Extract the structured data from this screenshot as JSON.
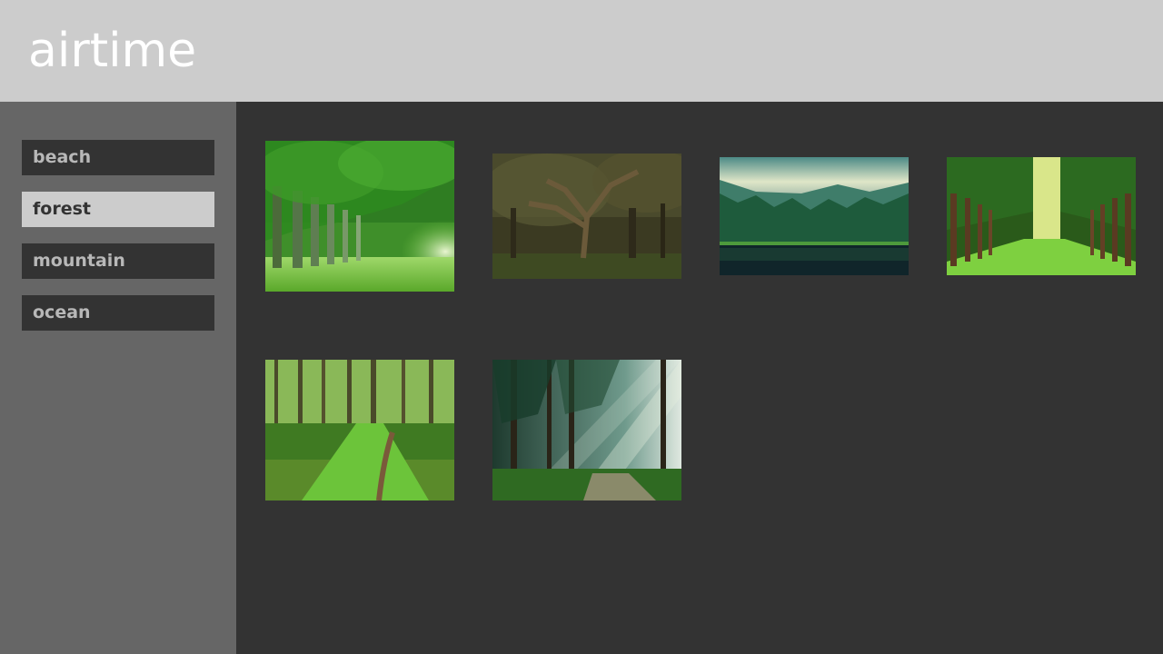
{
  "header": {
    "logo_text": "airtime",
    "background": "#cccccc"
  },
  "sidebar": {
    "items": [
      {
        "label": "beach",
        "selected": false
      },
      {
        "label": "forest",
        "selected": true
      },
      {
        "label": "mountain",
        "selected": false
      },
      {
        "label": "ocean",
        "selected": false
      }
    ]
  },
  "gallery": {
    "category": "forest",
    "images": [
      {
        "subject": "green tree tunnel over grass"
      },
      {
        "subject": "old spreading oak tree in dark forest"
      },
      {
        "subject": "mountain lake lined with pine forest"
      },
      {
        "subject": "tree-lined green avenue"
      },
      {
        "subject": "grassy trail through green woods"
      },
      {
        "subject": "sunbeams through pine forest"
      }
    ]
  },
  "colors": {
    "page_bg": "#333333",
    "sidebar_bg": "#666666",
    "item_bg": "#333333",
    "item_text": "#b8b8b8",
    "selected_bg": "#cccccc",
    "selected_text": "#333333"
  }
}
